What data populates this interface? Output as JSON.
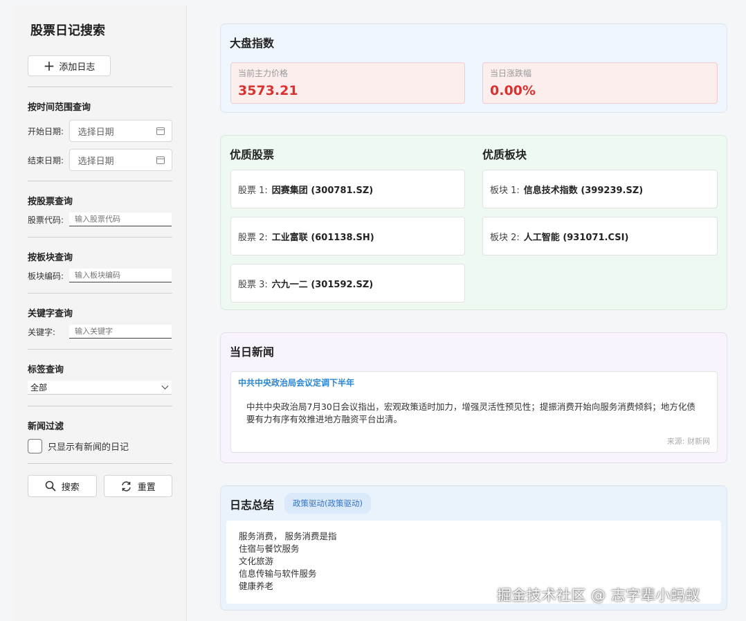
{
  "sidebar": {
    "title": "股票日记搜索",
    "add_label": "添加日志",
    "time_section": "按时间范围查询",
    "start_label": "开始日期:",
    "start_placeholder": "选择日期",
    "end_label": "结束日期:",
    "end_placeholder": "选择日期",
    "stock_section": "按股票查询",
    "stock_label": "股票代码:",
    "stock_placeholder": "输入股票代码",
    "sector_section": "按板块查询",
    "sector_label": "板块编码:",
    "sector_placeholder": "输入板块编码",
    "keyword_section": "关键字查询",
    "keyword_label": "关键字:",
    "keyword_placeholder": "输入关键字",
    "tag_section": "标签查询",
    "tag_selected": "全部",
    "news_section": "新闻过滤",
    "news_checkbox_label": "只显示有新闻的日记",
    "search_label": "搜索",
    "reset_label": "重置"
  },
  "market": {
    "title": "大盘指数",
    "price_label": "当前主力价格",
    "price_value": "3573.21",
    "change_label": "当日涨跌幅",
    "change_value": "0.00%"
  },
  "quality": {
    "stocks_title": "优质股票",
    "stocks": [
      {
        "prefix": "股票 1:",
        "name": "因赛集团 (300781.SZ)"
      },
      {
        "prefix": "股票 2:",
        "name": "工业富联 (601138.SH)"
      },
      {
        "prefix": "股票 3:",
        "name": "六九一二 (301592.SZ)"
      }
    ],
    "sectors_title": "优质板块",
    "sectors": [
      {
        "prefix": "板块 1:",
        "name": "信息技术指数 (399239.SZ)"
      },
      {
        "prefix": "板块 2:",
        "name": "人工智能 (931071.CSI)"
      }
    ]
  },
  "news": {
    "title": "当日新闻",
    "headline": "中共中央政治局会议定调下半年",
    "body": "中共中央政治局7月30日会议指出，宏观政策适时加力，增强灵活性预见性；提振消费开始向服务消费倾斜；地方化债要有力有序有效推进地方融资平台出清。",
    "source": "来源: 财新网"
  },
  "summary": {
    "title": "日志总结",
    "tag": "政策驱动(政策驱动)",
    "lines": [
      "服务消费， 服务消费是指",
      "住宿与餐饮服务",
      "文化旅游",
      "信息传输与软件服务",
      "健康养老"
    ]
  },
  "watermark": "掘金技术社区 @ 志字辈小蚂蚁",
  "colors": {
    "accent_red": "#d9322f",
    "news_link": "#2a86d4",
    "tag_blue": "#3773c2"
  }
}
